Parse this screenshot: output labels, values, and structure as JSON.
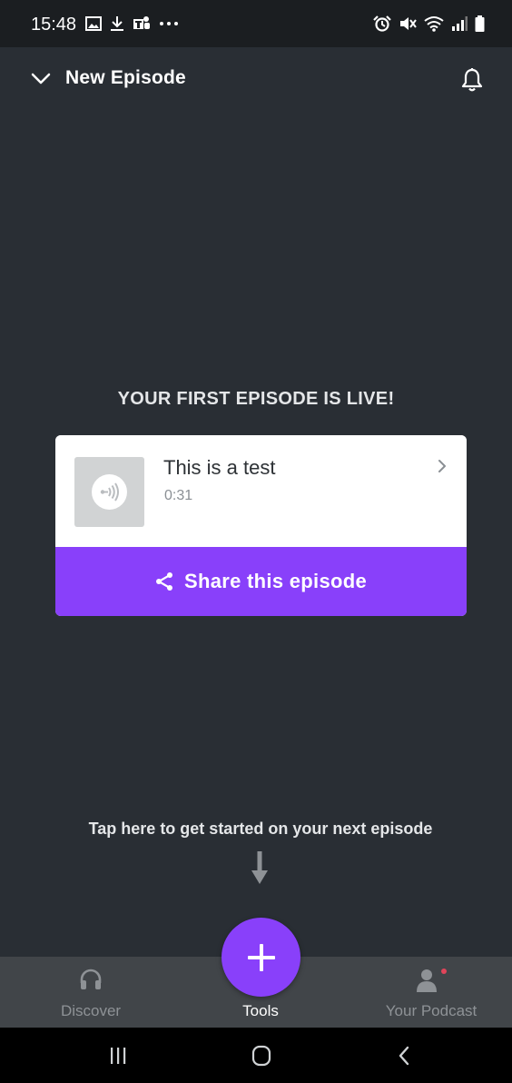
{
  "status_bar": {
    "time": "15:48",
    "left_icons": [
      "gallery-icon",
      "download-icon",
      "teams-icon",
      "more-dots-icon"
    ],
    "right_icons": [
      "alarm-icon",
      "mute-icon",
      "wifi-icon",
      "signal-icon",
      "battery-icon"
    ]
  },
  "header": {
    "title": "New Episode",
    "left_icon": "chevron-down-icon",
    "right_icon": "bell-icon"
  },
  "main": {
    "heading": "YOUR FIRST EPISODE IS LIVE!",
    "episode": {
      "title": "This is a test",
      "duration": "0:31",
      "thumbnail_icon": "podcast-logo-icon"
    },
    "share_label": "Share this episode",
    "hint": "Tap here to get started on your next episode"
  },
  "tabs": [
    {
      "label": "Discover",
      "icon": "headphones-icon",
      "active": false
    },
    {
      "label": "Tools",
      "icon": "plus-icon",
      "active": true
    },
    {
      "label": "Your Podcast",
      "icon": "person-icon",
      "active": false
    }
  ],
  "colors": {
    "accent": "#8940fa",
    "background": "#292e34",
    "tab_bar": "#414549",
    "notification_dot": "#e0455a"
  },
  "system_nav": [
    "recents-icon",
    "home-icon",
    "back-icon"
  ]
}
